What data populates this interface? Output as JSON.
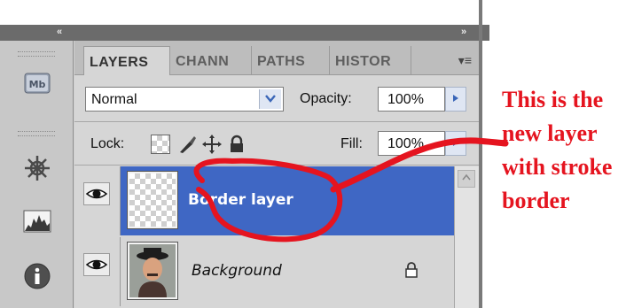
{
  "panel": {
    "collapse_left": "«",
    "collapse_right": "»",
    "menu_glyph": "▾≡"
  },
  "dock": {
    "icons": [
      "mini-bridge-icon",
      "navigator-icon",
      "histogram-icon",
      "info-icon"
    ],
    "mini_bridge_text": "Mb"
  },
  "tabs": [
    {
      "label": "LAYERS",
      "active": true
    },
    {
      "label": "CHANN",
      "active": false
    },
    {
      "label": "PATHS",
      "active": false
    },
    {
      "label": "HISTOR",
      "active": false
    }
  ],
  "blend": {
    "mode": "Normal",
    "opacity_label": "Opacity:",
    "opacity_value": "100%",
    "lock_label": "Lock:",
    "fill_label": "Fill:",
    "fill_value": "100%"
  },
  "layers": [
    {
      "name": "Border layer",
      "selected": true,
      "visible": true
    },
    {
      "name": "Background",
      "selected": false,
      "visible": true,
      "locked": true
    }
  ],
  "annotation": {
    "lines": [
      "This is the",
      "new layer",
      "with stroke",
      "border"
    ],
    "color": "#e5141f"
  },
  "colors": {
    "selection": "#3f67c4",
    "panel_bg": "#d6d6d6",
    "topbar": "#6b6b6b"
  }
}
